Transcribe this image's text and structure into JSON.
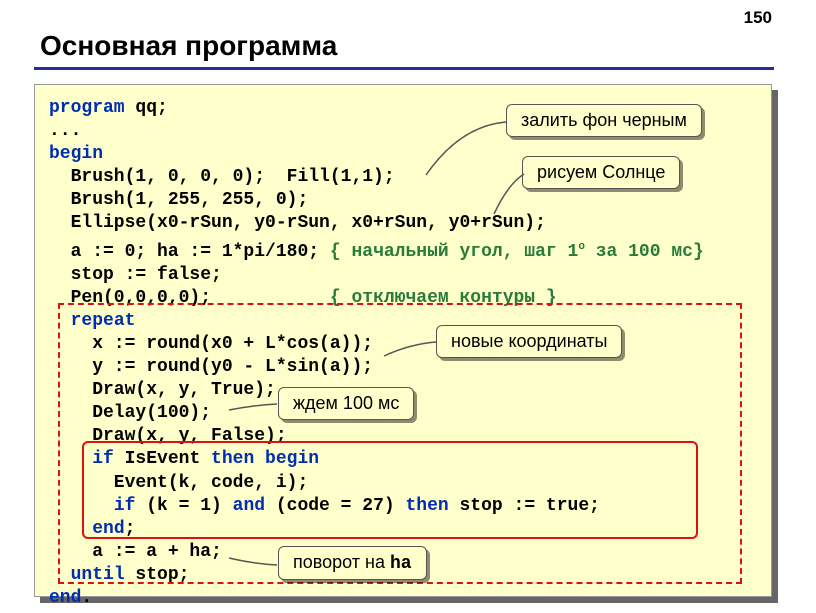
{
  "page_number": "150",
  "title": "Основная программа",
  "code": {
    "l1a": "program",
    "l1b": " qq;",
    "l2": "...",
    "l3": "begin",
    "l4": "  Brush(1, 0, 0, 0);  Fill(1,1);",
    "l5": "  Brush(1, 255, 255, 0);",
    "l6": "  Ellipse(x0-rSun, y0-rSun, x0+rSun, y0+rSun);",
    "l7a": "  a := 0; ha := 1*pi/180; ",
    "l7c": "{ начальный угол, шаг 1",
    "l7c2": " за 100 мс}",
    "deg": "o",
    "l8": "  stop := false;",
    "l9a": "  Pen(0,0,0,0);           ",
    "l9c": "{ отключаем контуры }",
    "l10a": "  ",
    "l10b": "repeat",
    "l11": "    x := round(x0 + L*cos(a));",
    "l12": "    y := round(y0 - L*sin(a));",
    "l13": "    Draw(x, y, True);",
    "l14": "    Delay(100);",
    "l15": "    Draw(x, y, False);",
    "l16a": "    ",
    "l16b": "if",
    "l16c": " IsEvent ",
    "l16d": "then begin",
    "l17": "      Event(k, code, i);",
    "l18a": "      ",
    "l18b": "if",
    "l18c": " (k = 1) ",
    "l18d": "and",
    "l18e": " (code = 27) ",
    "l18f": "then",
    "l18g": " stop := true;",
    "l19a": "    ",
    "l19b": "end",
    "l19c": ";",
    "l20": "    a := a + ha;",
    "l21a": "  ",
    "l21b": "until",
    "l21c": " stop;",
    "l22a": "end",
    "l22b": "."
  },
  "callouts": {
    "fill_black": "залить фон черным",
    "draw_sun": "рисуем Солнце",
    "new_coords": "новые координаты",
    "wait": "ждем 100 мс",
    "rotate_pre": "поворот на ",
    "rotate_mono": "ha"
  }
}
